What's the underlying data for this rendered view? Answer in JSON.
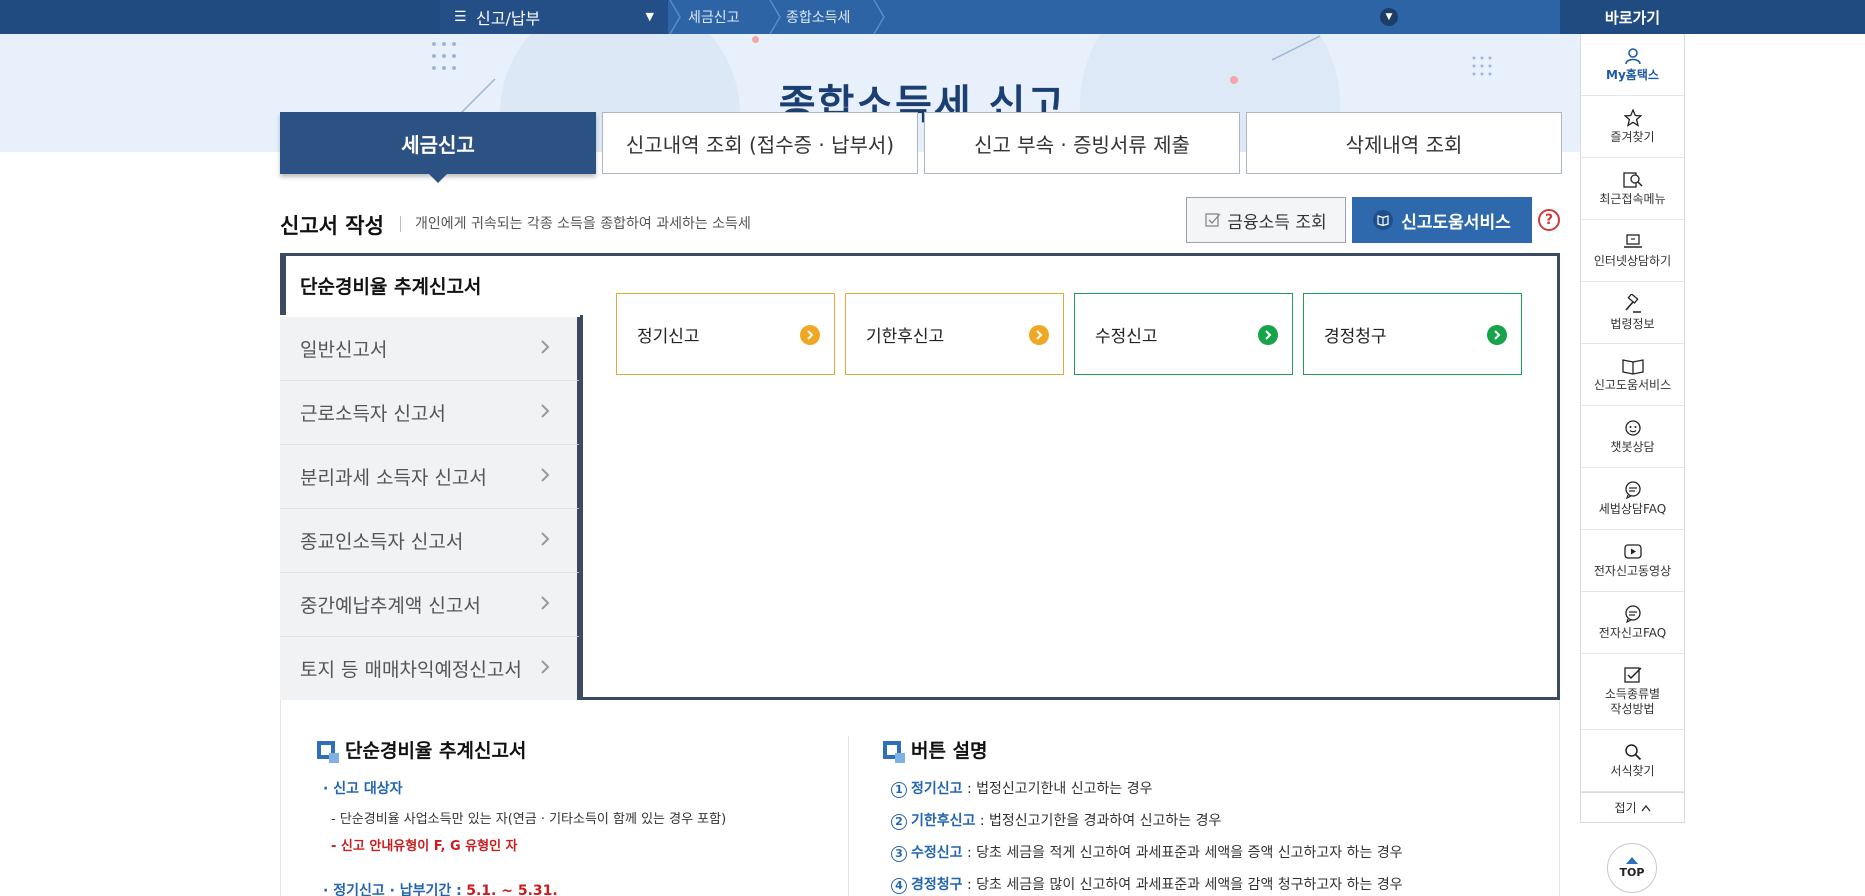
{
  "breadcrumb": {
    "menu_label": "신고/납부",
    "items": [
      "세금신고",
      "종합소득세"
    ]
  },
  "hero": {
    "title": "종합소득세 신고"
  },
  "tabs": [
    {
      "label": "세금신고",
      "active": true
    },
    {
      "label": "신고내역 조회 (접수증 · 납부서)",
      "active": false
    },
    {
      "label": "신고 부속 · 증빙서류 제출",
      "active": false
    },
    {
      "label": "삭제내역 조회",
      "active": false
    }
  ],
  "section": {
    "title": "신고서 작성",
    "description": "개인에게 귀속되는 각종 소득을 종합하여 과세하는 소득세",
    "finance_button": "금융소득 조회",
    "help_button": "신고도움서비스",
    "help_icon": "?"
  },
  "form_types": {
    "selected": "단순경비율 추계신고서",
    "items": [
      "일반신고서",
      "근로소득자 신고서",
      "분리과세 소득자 신고서",
      "종교인소득자 신고서",
      "중간예납추계액 신고서",
      "토지 등 매매차익예정신고서"
    ]
  },
  "actions": [
    {
      "label": "정기신고",
      "color": "#f0a824"
    },
    {
      "label": "기한후신고",
      "color": "#f0a824"
    },
    {
      "label": "수정신고",
      "color": "#16a34a"
    },
    {
      "label": "경정청구",
      "color": "#16a34a"
    }
  ],
  "desc_left": {
    "title": "단순경비율 추계신고서",
    "target_label": "· 신고 대상자",
    "line1": "- 단순경비율 사업소득만 있는 자(연금 · 기타소득이 함께 있는 경우 포함)",
    "line2": "- 신고 안내유형이 F, G 유형인 자",
    "period_label": "· 정기신고 · 납부기간 :",
    "period_value": "5.1. ~ 5.31."
  },
  "desc_right": {
    "title": "버튼 설명",
    "items": [
      {
        "num": "1",
        "term": "정기신고",
        "text": " : 법정신고기한내 신고하는 경우"
      },
      {
        "num": "2",
        "term": "기한후신고",
        "text": " : 법정신고기한을 경과하여 신고하는 경우"
      },
      {
        "num": "3",
        "term": "수정신고",
        "text": " : 당초 세금을 적게 신고하여 과세표준과 세액을 증액 신고하고자 하는 경우"
      },
      {
        "num": "4",
        "term": "경정청구",
        "text": " : 당초 세금을 많이 신고하여 과세표준과 세액을 감액 청구하고자 하는 경우"
      }
    ]
  },
  "quick": {
    "header": "바로가기",
    "items": [
      {
        "label": "My홈택스",
        "icon": "user-icon"
      },
      {
        "label": "즐겨찾기",
        "icon": "star-icon"
      },
      {
        "label": "최근접속메뉴",
        "icon": "recent-search-icon"
      },
      {
        "label": "인터넷상담하기",
        "icon": "laptop-icon"
      },
      {
        "label": "법령정보",
        "icon": "gavel-icon"
      },
      {
        "label": "신고도움서비스",
        "icon": "book-icon"
      },
      {
        "label": "챗봇상담",
        "icon": "chatbot-icon"
      },
      {
        "label": "세법상담FAQ",
        "icon": "chat-bubble-icon"
      },
      {
        "label": "전자신고동영상",
        "icon": "video-play-icon"
      },
      {
        "label": "전자신고FAQ",
        "icon": "chat-bubble-icon"
      },
      {
        "label": "소득종류별\n작성방법",
        "icon": "checklist-icon"
      },
      {
        "label": "서식찾기",
        "icon": "search-icon"
      }
    ],
    "fold_label": "접기",
    "top_label": "TOP"
  }
}
